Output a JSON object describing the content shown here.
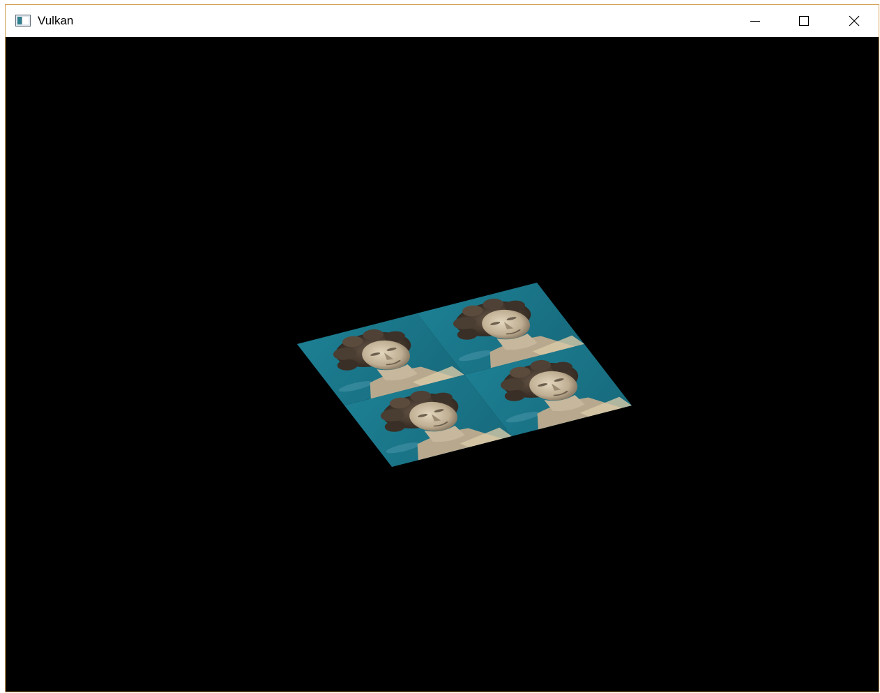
{
  "window": {
    "title": "Vulkan",
    "frame_accent": "#d4a25a",
    "background": "#000000"
  },
  "titlebar": {
    "app_icon": "app-window-icon",
    "buttons": [
      {
        "name": "minimize-button",
        "icon": "minimize-icon"
      },
      {
        "name": "maximize-button",
        "icon": "maximize-icon"
      },
      {
        "name": "close-button",
        "icon": "close-icon"
      }
    ]
  },
  "scene": {
    "object": "textured-plane",
    "texture_tiles": 4,
    "texture_sky_color": "#1f7d90",
    "texture_statue_color": "#c9bca3"
  }
}
